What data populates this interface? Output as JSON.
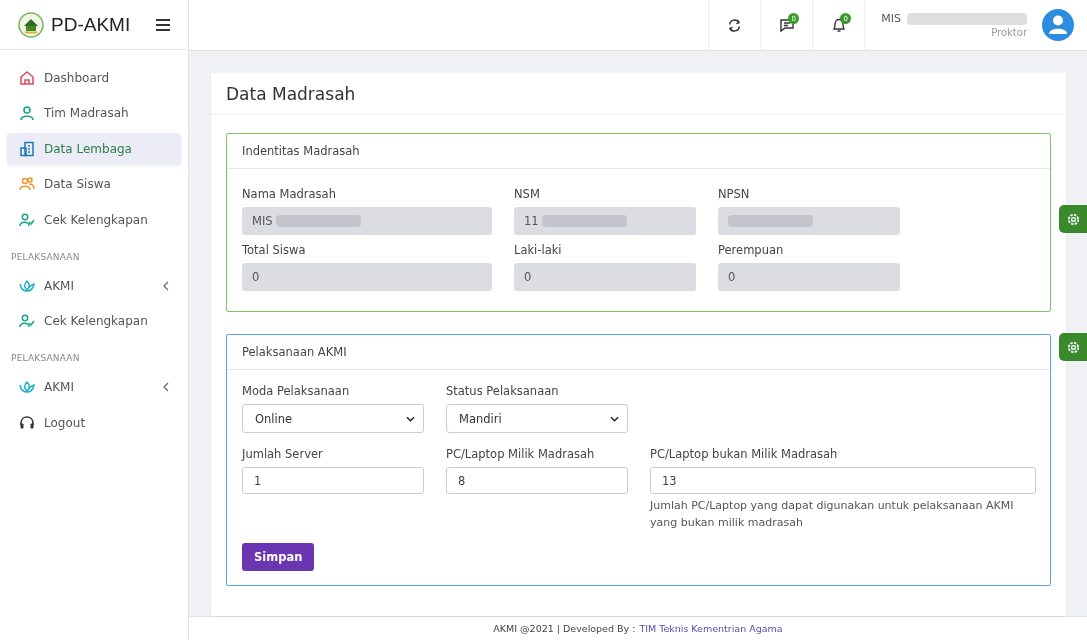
{
  "brand": "PD-AKMI",
  "topbar": {
    "messages_badge": "0",
    "notifications_badge": "0",
    "user_name": "MIS",
    "user_redacted": true,
    "user_role": "Proktor"
  },
  "sidebar": {
    "items": [
      {
        "kind": "item",
        "label": "Dashboard",
        "selected": false
      },
      {
        "kind": "item",
        "label": "Tim Madrasah",
        "selected": false
      },
      {
        "kind": "item",
        "label": "Data Lembaga",
        "selected": true
      },
      {
        "kind": "item",
        "label": "Data Siswa",
        "selected": false
      },
      {
        "kind": "item",
        "label": "Cek Kelengkapan",
        "selected": false
      },
      {
        "kind": "heading",
        "label": "PELAKSANAAN"
      },
      {
        "kind": "item",
        "label": "AKMI",
        "selected": false,
        "expandable": true
      },
      {
        "kind": "item",
        "label": "Cek Kelengkapan",
        "selected": false
      },
      {
        "kind": "heading",
        "label": "PELAKSANAAN"
      },
      {
        "kind": "item",
        "label": "AKMI",
        "selected": false,
        "expandable": true
      },
      {
        "kind": "item",
        "label": "Logout",
        "selected": false
      }
    ]
  },
  "page_title": "Data Madrasah",
  "identity": {
    "title": "Indentitas Madrasah",
    "fields": [
      {
        "label": "Nama Madrasah",
        "value": "MIS",
        "redacted": true
      },
      {
        "label": "NSM",
        "value": "11",
        "redacted": true
      },
      {
        "label": "NPSN",
        "redacted": true
      },
      {
        "label": "Total Siswa",
        "value": "0"
      },
      {
        "label": "Laki-laki",
        "value": "0"
      },
      {
        "label": "Perempuan",
        "value": "0"
      }
    ]
  },
  "execution": {
    "title": "Pelaksanaan AKMI",
    "selects": [
      {
        "label": "Moda Pelaksanaan",
        "value": "Online"
      },
      {
        "label": "Status Pelaksanaan",
        "value": "Mandiri"
      }
    ],
    "inputs": [
      {
        "label": "Jumlah Server",
        "value": "1"
      },
      {
        "label": "PC/Laptop Milik Madrasah",
        "value": "8"
      },
      {
        "label": "PC/Laptop bukan Milik Madrasah",
        "value": "13",
        "help": "Jumlah PC/Laptop yang dapat digunakan untuk pelaksanaan AKMI yang bukan milik madrasah"
      }
    ],
    "submit": "Simpan"
  },
  "footer": {
    "text": "AKMI @2021 | Developed By :",
    "link": "TIM Teknis Kementrian Agama"
  }
}
